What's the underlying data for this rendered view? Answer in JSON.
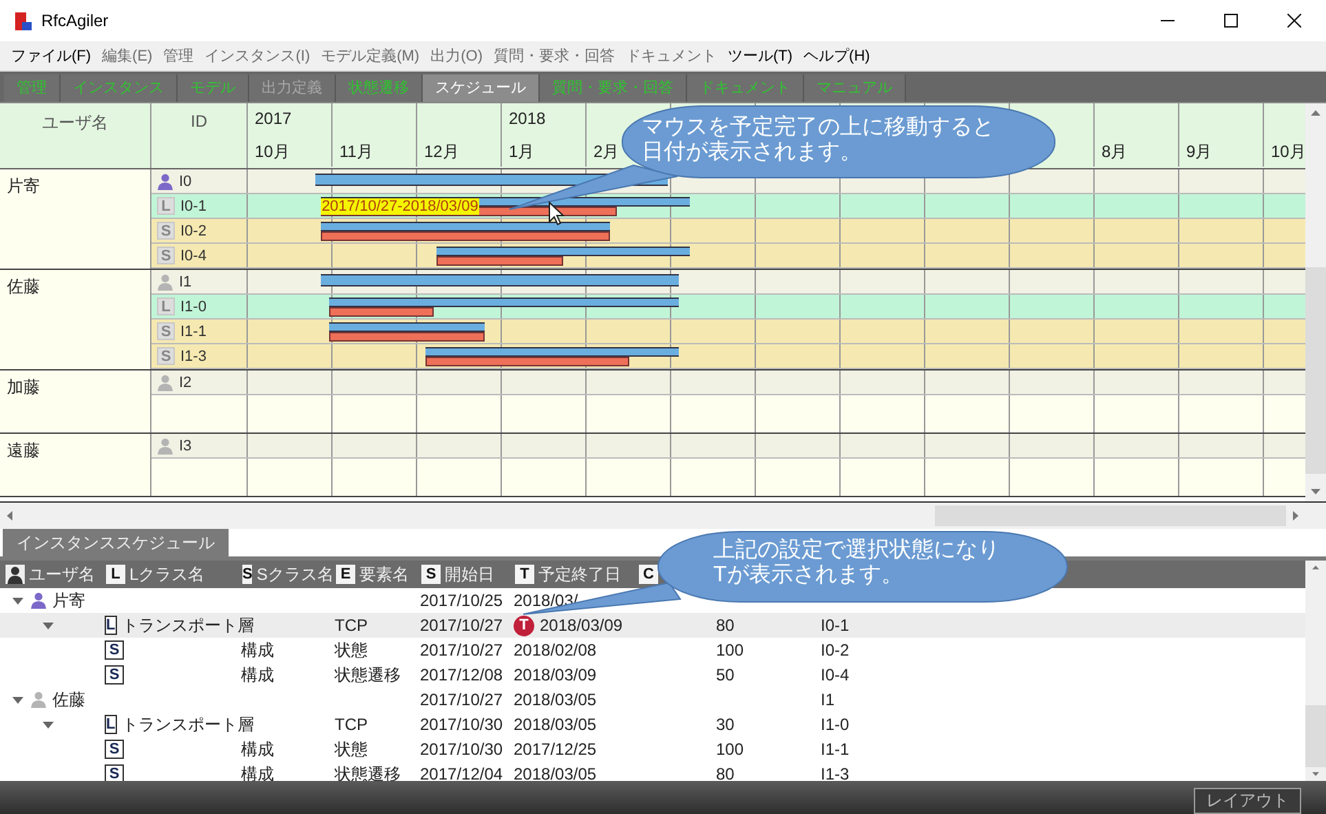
{
  "window": {
    "title": "RfcAgiler"
  },
  "menu": [
    {
      "label": "ファイル(F)",
      "disabled": false
    },
    {
      "label": "編集(E)",
      "disabled": true
    },
    {
      "label": "管理",
      "disabled": true
    },
    {
      "label": "インスタンス(I)",
      "disabled": true
    },
    {
      "label": "モデル定義(M)",
      "disabled": true
    },
    {
      "label": "出力(O)",
      "disabled": true
    },
    {
      "label": "質問・要求・回答",
      "disabled": true
    },
    {
      "label": "ドキュメント",
      "disabled": true
    },
    {
      "label": "ツール(T)",
      "disabled": false
    },
    {
      "label": "ヘルプ(H)",
      "disabled": false
    }
  ],
  "tabs": [
    {
      "label": "管理",
      "selected": false,
      "disabled": false
    },
    {
      "label": "インスタンス",
      "selected": false,
      "disabled": false
    },
    {
      "label": "モデル",
      "selected": false,
      "disabled": false
    },
    {
      "label": "出力定義",
      "selected": false,
      "disabled": true
    },
    {
      "label": "状態遷移",
      "selected": false,
      "disabled": false
    },
    {
      "label": "スケジュール",
      "selected": true,
      "disabled": false
    },
    {
      "label": "質問・要求・回答",
      "selected": false,
      "disabled": false
    },
    {
      "label": "ドキュメント",
      "selected": false,
      "disabled": false
    },
    {
      "label": "マニュアル",
      "selected": false,
      "disabled": false
    }
  ],
  "gantt": {
    "columns": [
      "ユーザ名",
      "ID"
    ],
    "months_left": [
      {
        "year": "2017",
        "label": "10月"
      },
      {
        "label": "11月"
      },
      {
        "label": "12月"
      },
      {
        "year": "2018",
        "label": "1月"
      },
      {
        "label": "2月"
      }
    ],
    "months_right": [
      {
        "label": "8月"
      },
      {
        "label": "9月"
      },
      {
        "label": "10月"
      }
    ],
    "users": [
      {
        "name": "片寄",
        "color": "#7b68c8",
        "rows": [
          {
            "kind": "user",
            "id": "I0"
          },
          {
            "kind": "L",
            "badge": "L",
            "id": "I0-1",
            "tooltip": "2017/10/27-2018/03/09"
          },
          {
            "kind": "S",
            "badge": "S",
            "id": "I0-2"
          },
          {
            "kind": "S",
            "badge": "S",
            "id": "I0-4"
          }
        ]
      },
      {
        "name": "佐藤",
        "color": "#b4b4b4",
        "rows": [
          {
            "kind": "user",
            "id": "I1"
          },
          {
            "kind": "L",
            "badge": "L",
            "id": "I1-0"
          },
          {
            "kind": "S",
            "badge": "S",
            "id": "I1-1"
          },
          {
            "kind": "S",
            "badge": "S",
            "id": "I1-3"
          }
        ]
      },
      {
        "name": "加藤",
        "color": "#b4b4b4",
        "rows": [
          {
            "kind": "user",
            "id": "I2"
          },
          {
            "kind": "blank"
          }
        ]
      },
      {
        "name": "遠藤",
        "color": "#b4b4b4",
        "rows": [
          {
            "kind": "user",
            "id": "I3"
          },
          {
            "kind": "blank"
          }
        ]
      }
    ]
  },
  "panel_tabs": [
    {
      "label": "インスタンススケジュール",
      "selected": true
    }
  ],
  "table": {
    "columns": [
      {
        "kind": "person",
        "label": "ユーザ名"
      },
      {
        "kind": "letter",
        "badge": "L",
        "label": "Lクラス名"
      },
      {
        "kind": "letter",
        "badge": "S",
        "label": "Sクラス名"
      },
      {
        "kind": "letter",
        "badge": "E",
        "label": "要素名"
      },
      {
        "kind": "letter",
        "badge": "S",
        "label": "開始日"
      },
      {
        "kind": "letter",
        "badge": "T",
        "label": "予定終了日"
      },
      {
        "kind": "letter",
        "badge": "C"
      }
    ],
    "rows": [
      {
        "kind": "user",
        "name": "片寄",
        "color": "#7b68c8",
        "expanded": true,
        "selected": false,
        "start": "2017/10/25",
        "end": "2018/03/",
        "children": [
          {
            "kind": "L",
            "badge": "L",
            "lclass": "トランスポート層",
            "element": "TCP",
            "start": "2017/10/27",
            "marker": "T",
            "end": "2018/03/09",
            "progress": "80",
            "id": "I0-1",
            "expanded": true,
            "selected": true,
            "children": [
              {
                "kind": "S",
                "badge": "S",
                "sclass": "構成",
                "element": "状態",
                "start": "2017/10/27",
                "end": "2018/02/08",
                "progress": "100",
                "id": "I0-2",
                "selected": false
              },
              {
                "kind": "S",
                "badge": "S",
                "sclass": "構成",
                "element": "状態遷移",
                "start": "2017/12/08",
                "end": "2018/03/09",
                "progress": "50",
                "id": "I0-4",
                "selected": false
              }
            ]
          }
        ]
      },
      {
        "kind": "user",
        "name": "佐藤",
        "color": "#b4b4b4",
        "expanded": true,
        "selected": false,
        "start": "2017/10/27",
        "end": "2018/03/05",
        "id": "I1",
        "children": [
          {
            "kind": "L",
            "badge": "L",
            "lclass": "トランスポート層",
            "element": "TCP",
            "start": "2017/10/30",
            "end": "2018/03/05",
            "progress": "30",
            "id": "I1-0",
            "expanded": true,
            "selected": false,
            "children": [
              {
                "kind": "S",
                "badge": "S",
                "sclass": "構成",
                "element": "状態",
                "start": "2017/10/30",
                "end": "2017/12/25",
                "progress": "100",
                "id": "I1-1",
                "selected": false
              },
              {
                "kind": "S",
                "badge": "S",
                "sclass": "構成",
                "element": "状態遷移",
                "start": "2017/12/04",
                "end": "2018/03/05",
                "progress": "80",
                "id": "I1-3",
                "selected": false
              }
            ]
          }
        ]
      }
    ]
  },
  "callouts": [
    {
      "lines": [
        "マウスを予定完了の上に移動すると",
        "日付が表示されます。"
      ]
    },
    {
      "lines": [
        "上記の設定で選択状態になり",
        "Tが表示されます。"
      ]
    }
  ],
  "footer": {
    "button": "レイアウト"
  }
}
